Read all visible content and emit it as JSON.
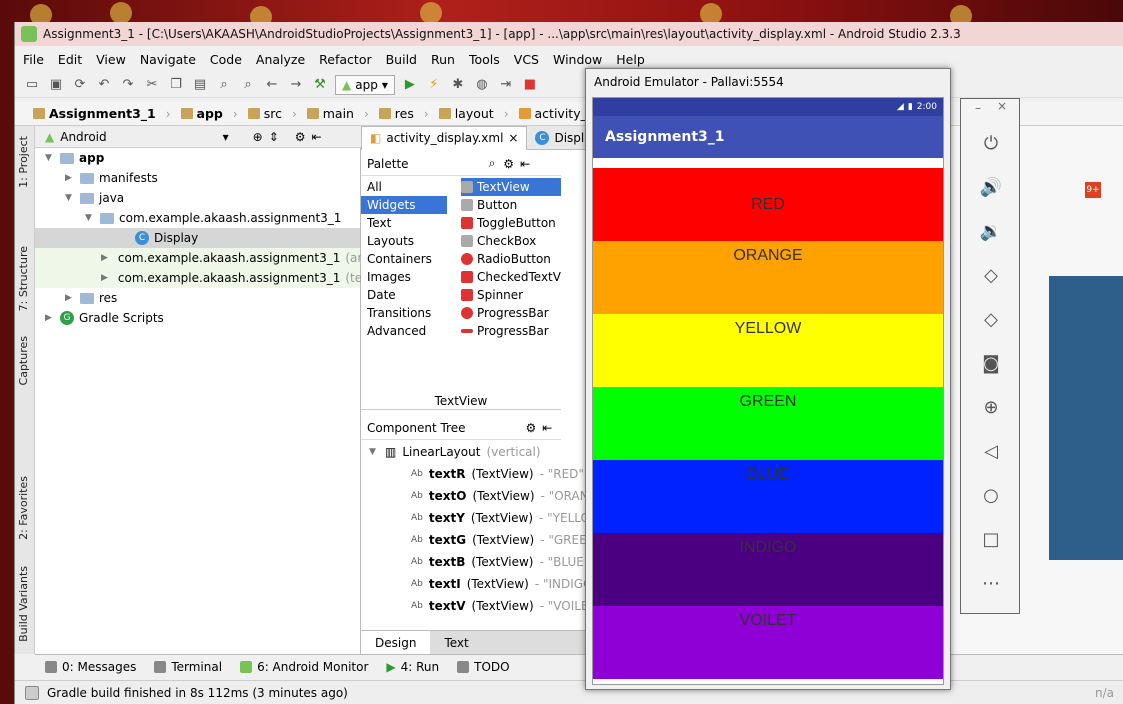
{
  "window": {
    "title": "Assignment3_1 - [C:\\Users\\AKAASH\\AndroidStudioProjects\\Assignment3_1] - [app] - ...\\app\\src\\main\\res\\layout\\activity_display.xml - Android Studio 2.3.3"
  },
  "menu": [
    "File",
    "Edit",
    "View",
    "Navigate",
    "Code",
    "Analyze",
    "Refactor",
    "Build",
    "Run",
    "Tools",
    "VCS",
    "Window",
    "Help"
  ],
  "toolbar": {
    "run_config": "app"
  },
  "breadcrumbs": [
    "Assignment3_1",
    "app",
    "src",
    "main",
    "res",
    "layout",
    "activity_display.xml"
  ],
  "side_tabs": [
    "1: Project",
    "7: Structure",
    "Captures",
    "2: Favorites",
    "Build Variants"
  ],
  "project": {
    "view": "Android",
    "tree": [
      {
        "label": "app",
        "bold": true
      },
      {
        "label": "manifests"
      },
      {
        "label": "java"
      },
      {
        "label": "com.example.akaash.assignment3_1"
      },
      {
        "label": "Display"
      },
      {
        "label": "com.example.akaash.assignment3_1",
        "suffix": "(androidTest)"
      },
      {
        "label": "com.example.akaash.assignment3_1",
        "suffix": "(test)"
      },
      {
        "label": "res"
      },
      {
        "label": "Gradle Scripts"
      }
    ]
  },
  "editor": {
    "tabs": [
      "activity_display.xml",
      "Display.java"
    ],
    "palette_title": "Palette",
    "palette_categories": [
      "All",
      "Widgets",
      "Text",
      "Layouts",
      "Containers",
      "Images",
      "Date",
      "Transitions",
      "Advanced"
    ],
    "palette_items": [
      "TextView",
      "Button",
      "ToggleButton",
      "CheckBox",
      "RadioButton",
      "CheckedTextView",
      "Spinner",
      "ProgressBar",
      "ProgressBar"
    ],
    "selected_widget": "TextView",
    "component_tree_title": "Component Tree",
    "root": {
      "name": "LinearLayout",
      "note": "(vertical)"
    },
    "components": [
      {
        "id": "textR",
        "type": "(TextView)",
        "value": "- \"RED\""
      },
      {
        "id": "textO",
        "type": "(TextView)",
        "value": "- \"ORANGE\""
      },
      {
        "id": "textY",
        "type": "(TextView)",
        "value": "- \"YELLOW\""
      },
      {
        "id": "textG",
        "type": "(TextView)",
        "value": "- \"GREEN\""
      },
      {
        "id": "textB",
        "type": "(TextView)",
        "value": "- \"BLUE\""
      },
      {
        "id": "textI",
        "type": "(TextView)",
        "value": "- \"INDIGO\""
      },
      {
        "id": "textV",
        "type": "(TextView)",
        "value": "- \"VOILET\""
      }
    ],
    "design_tabs": [
      "Design",
      "Text"
    ]
  },
  "bottom_tools": [
    "0: Messages",
    "Terminal",
    "6: Android Monitor",
    "4: Run",
    "TODO"
  ],
  "status": {
    "message": "Gradle build finished in 8s 112ms (3 minutes ago)",
    "right": "n/a"
  },
  "emulator": {
    "title": "Android Emulator - Pallavi:5554",
    "clock": "2:00",
    "app_title": "Assignment3_1",
    "bands": [
      {
        "label": "RED",
        "color": "#ff0000"
      },
      {
        "label": "ORANGE",
        "color": "#ffa200"
      },
      {
        "label": "YELLOW",
        "color": "#ffff00"
      },
      {
        "label": "GREEN",
        "color": "#00ff00"
      },
      {
        "label": "BLUE",
        "color": "#0022ff"
      },
      {
        "label": "INDIGO",
        "color": "#4b0082"
      },
      {
        "label": "VOILET",
        "color": "#8f00d6"
      }
    ]
  },
  "emulator_controls": [
    "power-icon",
    "volume-up-icon",
    "volume-down-icon",
    "rotate-left-icon",
    "rotate-right-icon",
    "camera-icon",
    "zoom-icon",
    "back-icon",
    "home-icon",
    "overview-icon",
    "more-icon"
  ]
}
